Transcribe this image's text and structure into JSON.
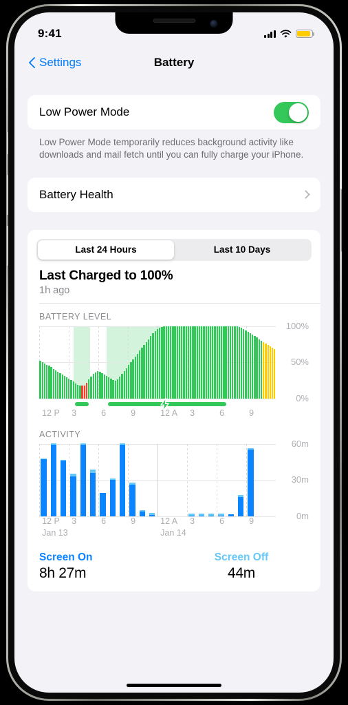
{
  "status_bar": {
    "time": "9:41",
    "signal_icon": "cellular-bars-icon",
    "wifi_icon": "wifi-icon",
    "battery_icon": "battery-low-power-icon",
    "battery_color": "#ffcc00"
  },
  "nav": {
    "back_label": "Settings",
    "title": "Battery"
  },
  "low_power": {
    "label": "Low Power Mode",
    "toggle_on": true,
    "toggle_color": "#34c759",
    "footnote": "Low Power Mode temporarily reduces background activity like downloads and mail fetch until you can fully charge your iPhone."
  },
  "battery_health": {
    "label": "Battery Health"
  },
  "segmented": {
    "options": [
      "Last 24 Hours",
      "Last 10 Days"
    ],
    "selected_index": 0
  },
  "last_charge": {
    "title": "Last Charged to 100%",
    "subtitle": "1h ago"
  },
  "summary": {
    "screen_on_label": "Screen On",
    "screen_on_value": "8h 27m",
    "screen_off_label": "Screen Off",
    "screen_off_value": "44m",
    "screen_on_color": "#0a84ff",
    "screen_off_color": "#64c8f8"
  },
  "chart_data": [
    {
      "type": "bar",
      "name": "battery-level-chart",
      "title": "BATTERY LEVEL",
      "ylabel": "",
      "xlabel": "",
      "ylim": [
        0,
        100
      ],
      "yticks": [
        0,
        50,
        100
      ],
      "ytick_labels": [
        "0%",
        "50%",
        "100%"
      ],
      "xtick_labels": [
        "12 P",
        "3",
        "6",
        "9",
        "12 A",
        "3",
        "6",
        "9"
      ],
      "xtick_positions": [
        0,
        12.5,
        25,
        37.5,
        50,
        62.5,
        75,
        87.5
      ],
      "grid": true,
      "colors": {
        "normal": "#34c759",
        "low": "#ff3b30",
        "low_power": "#ffcc00",
        "charging_band": "#d4f3dd"
      },
      "values": [
        52,
        50,
        48,
        46,
        45,
        43,
        41,
        39,
        37,
        35,
        33,
        31,
        29,
        27,
        25,
        23,
        21,
        19,
        18,
        18,
        18,
        22,
        26,
        30,
        34,
        36,
        38,
        37,
        35,
        33,
        31,
        29,
        27,
        25,
        24,
        26,
        30,
        34,
        38,
        42,
        46,
        50,
        54,
        58,
        62,
        66,
        70,
        74,
        78,
        82,
        86,
        90,
        93,
        96,
        98,
        99,
        100,
        100,
        100,
        100,
        100,
        100,
        100,
        100,
        100,
        100,
        100,
        100,
        100,
        100,
        100,
        100,
        100,
        100,
        100,
        100,
        100,
        100,
        100,
        100,
        100,
        100,
        100,
        100,
        100,
        100,
        100,
        100,
        100,
        100,
        99,
        98,
        96,
        94,
        92,
        90,
        88,
        86,
        84,
        82,
        80,
        78,
        76,
        74,
        72,
        70,
        68
      ],
      "bar_states": [
        "normal",
        "normal",
        "normal",
        "normal",
        "normal",
        "normal",
        "normal",
        "normal",
        "normal",
        "normal",
        "normal",
        "normal",
        "normal",
        "normal",
        "normal",
        "normal",
        "normal",
        "normal",
        "normal",
        "low",
        "low",
        "low",
        "normal",
        "normal",
        "normal",
        "normal",
        "normal",
        "normal",
        "normal",
        "normal",
        "normal",
        "normal",
        "normal",
        "normal",
        "normal",
        "normal",
        "normal",
        "normal",
        "normal",
        "normal",
        "normal",
        "normal",
        "normal",
        "normal",
        "normal",
        "normal",
        "normal",
        "normal",
        "normal",
        "normal",
        "normal",
        "normal",
        "normal",
        "normal",
        "normal",
        "normal",
        "normal",
        "normal",
        "normal",
        "normal",
        "normal",
        "normal",
        "normal",
        "normal",
        "normal",
        "normal",
        "normal",
        "normal",
        "normal",
        "normal",
        "normal",
        "normal",
        "normal",
        "normal",
        "normal",
        "normal",
        "normal",
        "normal",
        "normal",
        "normal",
        "normal",
        "normal",
        "normal",
        "normal",
        "normal",
        "normal",
        "normal",
        "normal",
        "normal",
        "normal",
        "normal",
        "normal",
        "normal",
        "normal",
        "normal",
        "normal",
        "normal",
        "normal",
        "normal",
        "normal",
        "normal",
        "low_power",
        "low_power",
        "low_power",
        "low_power",
        "low_power",
        "low_power"
      ],
      "charging_bands": [
        {
          "start_pct": 14.5,
          "end_pct": 21.5
        },
        {
          "start_pct": 28.5,
          "end_pct": 79.5
        }
      ],
      "charging_segments": [
        {
          "start_pct": 15.0,
          "end_pct": 21.0
        },
        {
          "start_pct": 29.0,
          "end_pct": 79.0,
          "bolt_at_pct": 53.0
        }
      ]
    },
    {
      "type": "bar",
      "name": "activity-chart",
      "title": "ACTIVITY",
      "ylabel": "",
      "xlabel": "",
      "ylim": [
        0,
        60
      ],
      "yticks": [
        0,
        30,
        60
      ],
      "ytick_labels": [
        "0m",
        "30m",
        "60m"
      ],
      "xtick_labels": [
        "12 P",
        "3",
        "6",
        "9",
        "12 A",
        "3",
        "6",
        "9"
      ],
      "xtick_positions": [
        0,
        12.5,
        25,
        37.5,
        50,
        62.5,
        75,
        87.5
      ],
      "date_labels": [
        {
          "text": "Jan 13",
          "pos_pct": 0
        },
        {
          "text": "Jan 14",
          "pos_pct": 50
        }
      ],
      "grid": true,
      "colors": {
        "screen_on": "#0a84ff",
        "screen_off": "#64c8f8"
      },
      "categories": [
        "12 P",
        "1 P",
        "2 P",
        "3 P",
        "4 P",
        "5 P",
        "6 P",
        "7 P",
        "8 P",
        "9 P",
        "10 P",
        "11 P",
        "12 A",
        "1 A",
        "2 A",
        "3 A",
        "4 A",
        "5 A",
        "6 A",
        "7 A",
        "8 A",
        "9 A",
        "10 A",
        "11 A"
      ],
      "series": [
        {
          "name": "Screen On",
          "values": [
            47,
            59,
            46,
            33,
            59,
            36,
            19,
            30,
            59,
            26,
            4,
            1,
            0,
            0,
            0,
            0.6,
            0.6,
            0.6,
            0.6,
            1.6,
            16,
            55,
            0,
            0
          ]
        },
        {
          "name": "Screen Off",
          "values": [
            0.8,
            1.2,
            0.8,
            2.2,
            1.2,
            2.6,
            0,
            1.2,
            1.2,
            1.6,
            1.2,
            1.6,
            0,
            0,
            0,
            1.4,
            1.4,
            1.4,
            1.4,
            0,
            1.6,
            1.6,
            0,
            0
          ]
        }
      ]
    }
  ]
}
